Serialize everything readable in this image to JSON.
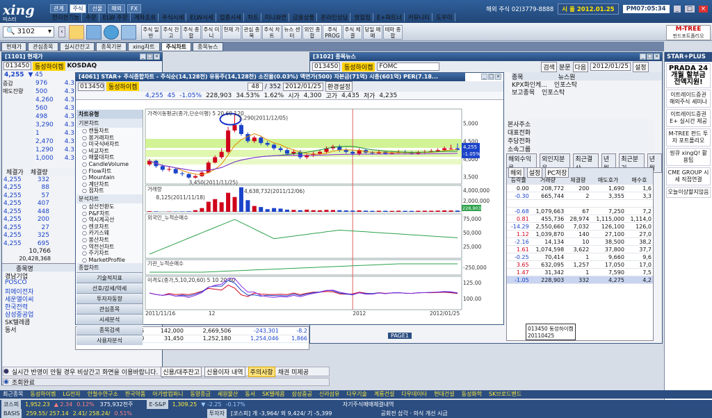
{
  "app": {
    "logo": "xing",
    "logo_sub": "미스터"
  },
  "menu1": [
    "관계",
    "주식",
    "선물",
    "해외",
    "FX"
  ],
  "menu2": [
    "편리한기능",
    "주문",
    "ELW 주문",
    "계좌조회",
    "주식시세",
    "ELW시세",
    "업종시세",
    "차트",
    "미니화면",
    "금융상품",
    "온라인상담",
    "영업점",
    "E+파트너",
    "커뮤니티",
    "도우미"
  ],
  "topright": {
    "phone": "해외 주식 02)3779-8888",
    "date": "시 올 2012.01.25",
    "time": "PM07:05:34"
  },
  "toolbar": {
    "code": "3102",
    "buttons": [
      "주식 일반",
      "주식 잔고",
      "주식 종합",
      "주식 미니",
      "현재 가",
      "관심 종목",
      "주식 차트",
      "뉴스 센터",
      "외인 종합",
      "주식 PROG",
      "주식 체결",
      "당일 매매",
      "테마 종합"
    ]
  },
  "mtree": {
    "line1": "M-TREE",
    "line2": "펀드포트폴리오"
  },
  "tabs": [
    "현재가",
    "관심종목",
    "실시간잔고",
    "종목기본",
    "xing차트",
    "주식차트",
    "종목뉴스"
  ],
  "winA": {
    "title": "[1101] 현재가",
    "code": "013450",
    "name": "동성하이켐",
    "market": "KOSDAQ",
    "price": "4,255",
    "chg": "45",
    "asks": [
      [
        "976",
        "4.3"
      ],
      [
        "500",
        "4.3"
      ],
      [
        "4,260",
        "4.3"
      ],
      [
        "560",
        "4.3"
      ],
      [
        "498",
        "4.3"
      ],
      [
        "3,290",
        "4.3"
      ],
      [
        "1",
        "4.3"
      ],
      [
        "2,470",
        "4.3"
      ],
      [
        "1,290",
        "4.3"
      ],
      [
        "1,000",
        "4.3"
      ]
    ],
    "bids": [
      [
        "4,255",
        "332"
      ],
      [
        "4,255",
        "88"
      ],
      [
        "4,255",
        "57"
      ],
      [
        "4,255",
        "407"
      ],
      [
        "4,255",
        "448"
      ],
      [
        "4,255",
        "200"
      ],
      [
        "4,255",
        "27"
      ],
      [
        "4,255",
        "325"
      ],
      [
        "4,255",
        "695"
      ]
    ],
    "hdr1": "체결가",
    "hdr2": "체결량",
    "total": "10,766",
    "vol": "20,428,368",
    "list_head": "종목명",
    "list": [
      [
        "경남기업",
        "",
        "",
        "",
        "",
        "",
        "",
        ""
      ],
      [
        "POSCO",
        "",
        "",
        "",
        "",
        "",
        "",
        ""
      ],
      [
        "피에이전자",
        "",
        "",
        "",
        "",
        "",
        "",
        ""
      ],
      [
        "세운엘이씨",
        "",
        "",
        "",
        "",
        "",
        "",
        ""
      ],
      [
        "한국전력",
        "",
        "",
        "",
        "",
        "",
        "",
        ""
      ],
      [
        "삼성중공업",
        "",
        "",
        "",
        "",
        "",
        "",
        ""
      ],
      [
        "SK텔레콤",
        "19",
        "19",
        "154,335",
        "142,000",
        "2,669,506",
        "-243,301",
        "-8.2"
      ],
      [
        "동서",
        "40",
        "40",
        "31,300",
        "31,450",
        "1,252,180",
        "1,254,046",
        "1,866"
      ]
    ],
    "foot1": "실시간 반영이 안될 경우 비상간고 화면을 이용바랍니다.",
    "foot_btns": [
      "신용/대주잔고",
      "신용이자 내역",
      "주의사항",
      "채권 미제공"
    ],
    "status": "조회완료"
  },
  "indmenu": {
    "head": "차트유형",
    "sec1": "기본차트",
    "items1": [
      "캔들차트",
      "봉거래차트",
      "미국식바차트",
      "비교차트",
      "매물대차트",
      "CandleVolume",
      "Flow차트",
      "Mountain",
      "계단차트",
      "점차트"
    ],
    "sec2": "분석차트",
    "items2": [
      "삼선전환도",
      "P&F차트",
      "역시계곡선",
      "렌코차트",
      "카기스웨",
      "봉산차트",
      "역전선차트",
      "주기차트",
      "MarketProfile"
    ],
    "sec3": "종합차트",
    "buttons": [
      "기술적지표",
      "선호/강세/약세",
      "투자자동향",
      "관심종목",
      "시세분석",
      "종목검색",
      "사용자분석"
    ]
  },
  "winC": {
    "title": "[4061] STAR+ 주식종합차트 - 주식순(14,128천) 유동주(14,128천) 소진율(0.03%) 액면가(500) 자본금(71억) 시총(601억) PER(7.18...",
    "code": "013450",
    "name": "동성하이켐",
    "date": "2012/01/25",
    "count": "48",
    "total": "352",
    "btn": "환경설정",
    "summary": [
      "4,255",
      "45",
      "-1.05%",
      "228,903",
      "34.53%",
      "1.62%",
      "시가",
      "4,300",
      "고가",
      "4,435",
      "저가",
      "4,235"
    ],
    "legend1": "가격이동평균(종가,단순이평) 5 20 60 120",
    "legend2": "거래량",
    "legend3": "외국인_누적순매수",
    "legend4": "기관_누적순매수",
    "legend5": "이격도(종가,5,10,20,60) 5 10 20 60",
    "xlabels": [
      "2011/11/16",
      "12",
      "2012",
      "2012/01/25"
    ],
    "annot_high": "5,290(2011/12/05)",
    "annot_low": "3,450(2011/11/25)",
    "annot_vol_hi": "4,638,732(2011/12/06)",
    "annot_vol_lo": "8,125(2011/11/18)",
    "ylab1": [
      "5,000",
      "4,500",
      "4,000",
      "3,500"
    ],
    "ylab2": [
      "4,000,000",
      "2,000,000"
    ],
    "ylab3": [
      "75,000",
      "50,000",
      "25,000"
    ],
    "ylab4": [
      "-250,000"
    ],
    "ylab5": [
      "125.00",
      "100.00"
    ],
    "last_price": "4,255",
    "last_pct": "-1.05%",
    "last_vol": "228,903"
  },
  "chart_data": {
    "type": "candlestick",
    "xlabel": "",
    "ylabel": "",
    "ylim": [
      3300,
      5400
    ],
    "x": [
      "11/16",
      "11/17",
      "11/18",
      "11/21",
      "11/22",
      "11/23",
      "11/24",
      "11/25",
      "11/28",
      "11/29",
      "11/30",
      "12/01",
      "12/02",
      "12/05",
      "12/06",
      "12/07",
      "12/08",
      "12/09",
      "12/12",
      "12/13",
      "12/14",
      "12/15",
      "12/16",
      "12/19",
      "12/20",
      "12/21",
      "12/22",
      "12/23",
      "12/26",
      "12/27",
      "12/28",
      "12/29",
      "01/02",
      "01/03",
      "01/04",
      "01/05",
      "01/06",
      "01/09",
      "01/10",
      "01/11",
      "01/12",
      "01/13",
      "01/16",
      "01/17",
      "01/18",
      "01/19",
      "01/20",
      "01/25"
    ],
    "open": [
      3850,
      3950,
      3800,
      3700,
      3720,
      3600,
      3580,
      3480,
      3520,
      3620,
      3900,
      4050,
      4200,
      4800,
      4950,
      4700,
      4500,
      4600,
      4450,
      4400,
      4300,
      4250,
      4150,
      4200,
      4050,
      4100,
      4150,
      4200,
      4300,
      4350,
      4250,
      4200,
      4150,
      4250,
      4180,
      4160,
      4200,
      4150,
      4180,
      4200,
      4170,
      4150,
      4190,
      4200,
      4220,
      4250,
      4300,
      4300
    ],
    "close": [
      3950,
      3800,
      3700,
      3720,
      3600,
      3580,
      3480,
      3520,
      3620,
      3900,
      4050,
      4200,
      4800,
      4950,
      4700,
      4500,
      4600,
      4450,
      4400,
      4300,
      4250,
      4150,
      4200,
      4050,
      4100,
      4150,
      4200,
      4300,
      4350,
      4250,
      4200,
      4150,
      4250,
      4180,
      4160,
      4200,
      4150,
      4180,
      4200,
      4170,
      4150,
      4190,
      4200,
      4220,
      4250,
      4300,
      4300,
      4255
    ],
    "high": [
      4000,
      3980,
      3850,
      3780,
      3750,
      3650,
      3600,
      3560,
      3680,
      3950,
      4100,
      4300,
      4900,
      5290,
      5000,
      4750,
      4650,
      4650,
      4500,
      4450,
      4350,
      4300,
      4250,
      4250,
      4150,
      4200,
      4250,
      4350,
      4400,
      4400,
      4300,
      4250,
      4300,
      4280,
      4220,
      4250,
      4220,
      4220,
      4250,
      4250,
      4220,
      4230,
      4250,
      4280,
      4300,
      4350,
      4400,
      4435
    ],
    "low": [
      3800,
      3750,
      3650,
      3650,
      3580,
      3520,
      3450,
      3450,
      3500,
      3600,
      3880,
      4000,
      4150,
      4750,
      4650,
      4450,
      4450,
      4400,
      4350,
      4250,
      4200,
      4100,
      4100,
      4000,
      4000,
      4050,
      4100,
      4150,
      4250,
      4200,
      4150,
      4100,
      4100,
      4150,
      4120,
      4130,
      4120,
      4120,
      4150,
      4150,
      4120,
      4120,
      4150,
      4180,
      4200,
      4220,
      4250,
      4235
    ],
    "volume": [
      120000,
      80000,
      8125,
      60000,
      50000,
      70000,
      90000,
      300000,
      700000,
      1900000,
      2400000,
      1800000,
      3600000,
      2800000,
      4638732,
      2200000,
      1100000,
      900000,
      500000,
      700000,
      600000,
      400000,
      350000,
      300000,
      400000,
      300000,
      280000,
      350000,
      330000,
      300000,
      250000,
      220000,
      260000,
      210000,
      180000,
      200000,
      190000,
      170000,
      200000,
      180000,
      170000,
      190000,
      210000,
      200000,
      220000,
      260000,
      240000,
      228903
    ]
  },
  "winN": {
    "title": "[3102] 종목뉴스",
    "code": "013450",
    "name": "동성하이켐",
    "filter": "FOMC",
    "date": "2012/01/25",
    "btns": [
      "검색",
      "분문",
      "다음",
      "설정"
    ],
    "cols": [
      "종목",
      "뉴스원"
    ],
    "rows": [
      [
        "KPX화인케...",
        "인포스탁"
      ],
      [
        "보고종목",
        "인포스탁"
      ]
    ],
    "side": [
      "본사주소",
      "대표전화",
      "주당전화",
      "소속그룹"
    ],
    "tabs2": [
      "해외수익률",
      "외인지분율",
      "최근결산",
      "년월",
      "최근분기",
      "년월"
    ],
    "tbl_head": [
      "등락률",
      "거래량",
      "체결량",
      "매도호가",
      "매수호"
    ],
    "tbl": [
      [
        "0.00",
        "208,772",
        "200",
        "1,690",
        "1,6"
      ],
      [
        "-0.30",
        "665,744",
        "2",
        "3,355",
        "3,3"
      ],
      [
        "",
        "",
        " ",
        "",
        ""
      ],
      [
        "-0.68",
        "1,079,663",
        "67",
        "7,250",
        "7,2"
      ],
      [
        "0.81",
        "455,736",
        "28,974",
        "1,115,000",
        "1,114,0"
      ],
      [
        "-14.29",
        "2,550,660",
        "7,032",
        "126,100",
        "126,0"
      ],
      [
        "1.12",
        "1,039,870",
        "140",
        "27,100",
        "27,0"
      ],
      [
        "-2.16",
        "14,134",
        "10",
        "38,500",
        "38,2"
      ],
      [
        "1.61",
        "1,074,598",
        "3,622",
        "37,800",
        "37,7"
      ],
      [
        "-0.25",
        "70,414",
        "1",
        "9,660",
        "9,6"
      ],
      [
        "3.65",
        "632,095",
        "1,257",
        "17,050",
        "17,0"
      ],
      [
        "1.47",
        "31,342",
        "1",
        "7,590",
        "7,5"
      ],
      [
        "-1.05",
        "228,903",
        "332",
        "4,275",
        "4,2"
      ]
    ],
    "footcode": "013450 동성하이켐",
    "footdate": "20110425",
    "page": "PAGE1"
  },
  "right": {
    "title": "STAR+PLUS",
    "ads": [
      "PRADA 24개월 할부금 전액지원!",
      "이트레이드증권 해외주식 세미나",
      "이트레이드증권 E+ 실시간 제공",
      "M-TREE 펀드 투자 포트폴리오",
      "씽큐 xingQ! 활용팁",
      "CME GROUP 시세 직접연결",
      "오늘이상할지않음"
    ]
  },
  "bottom1": [
    "최근종목",
    "동성하이켐",
    "LG전자",
    "안철수연구소",
    "한국약품",
    "아가방컴퍼니",
    "동양종금",
    "세원물산",
    "동서",
    "SK텔레콤",
    "삼성중공",
    "신라섬유",
    "다우기술",
    "계룡건설",
    "다우데이타",
    "현대건설",
    "동성화학",
    "SK브로드밴드"
  ],
  "bottom2": {
    "idx": "코스피",
    "v1": "1,952.23",
    "c1": "▲ 2.34",
    "p1": "0.12%",
    "q1": "375,932천주",
    "idx2": "E-S&P",
    "v2": "1,309.25",
    "c2": "▼ -2.25",
    "p2": "-0.17%",
    "news": "자기주식매매체결내역"
  },
  "bottom3": {
    "idx": "BASIS",
    "v": "259.55/ 257.14",
    "c": "2.41/ 258.24/",
    "p": "0.51%",
    "idx2": "투자자",
    "v2": "[코스피] 개 -3,964/ 외 9,424/ 기 -5,399",
    "news": "공회전 삽각 · 의식 개선 시급"
  }
}
